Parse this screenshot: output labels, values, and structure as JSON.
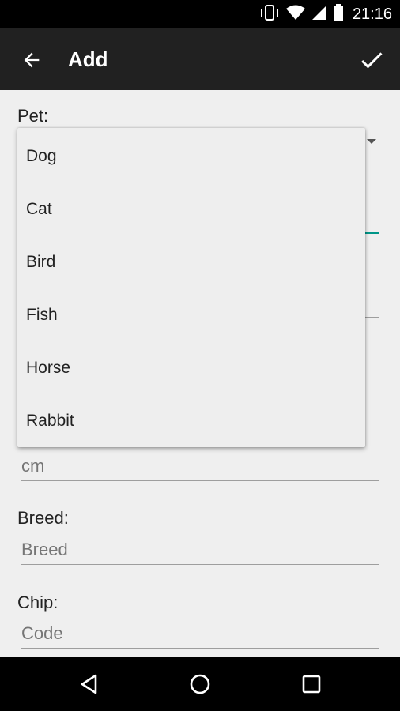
{
  "status_bar": {
    "time": "21:16",
    "icons": [
      "vibrate-icon",
      "wifi-icon",
      "cell-signal-icon",
      "battery-icon"
    ]
  },
  "app_bar": {
    "title": "Add",
    "back_icon": "arrow-left-icon",
    "confirm_icon": "check-icon"
  },
  "form": {
    "pet_label": "Pet:",
    "height_placeholder": "cm",
    "breed_label": "Breed:",
    "breed_placeholder": "Breed",
    "chip_label": "Chip:",
    "chip_placeholder": "Code"
  },
  "dropdown": {
    "options": [
      "Dog",
      "Cat",
      "Bird",
      "Fish",
      "Horse",
      "Rabbit"
    ]
  },
  "nav_bar": {
    "icons": [
      "back-triangle-icon",
      "home-circle-icon",
      "recents-square-icon"
    ]
  },
  "colors": {
    "app_bar": "#212121",
    "background": "#efefef",
    "accent": "#009688"
  }
}
